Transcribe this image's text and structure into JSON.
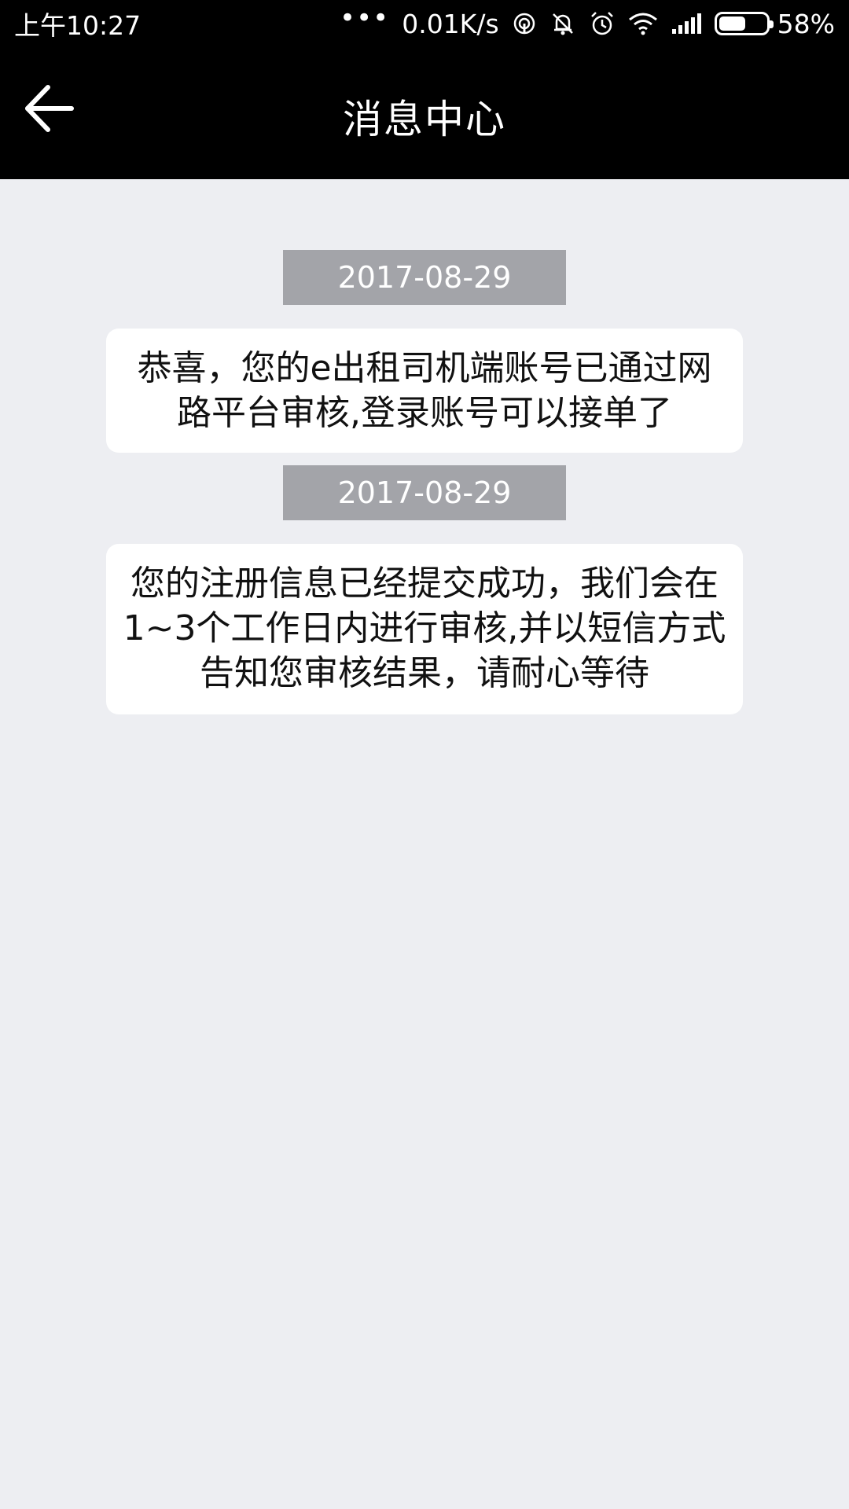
{
  "status_bar": {
    "time": "上午10:27",
    "dots": "•••",
    "network_speed": "0.01K/s",
    "battery_percent": "58%",
    "battery_level": 0.58
  },
  "header": {
    "title": "消息中心",
    "back_icon": "arrow-left-icon"
  },
  "messages": [
    {
      "date": "2017-08-29",
      "text": "恭喜，您的e出租司机端账号已通过网路平台审核,登录账号可以接单了"
    },
    {
      "date": "2017-08-29",
      "text": "您的注册信息已经提交成功，我们会在1~3个工作日内进行审核,并以短信方式告知您审核结果，请耐心等待"
    }
  ],
  "colors": {
    "header_bg": "#000000",
    "page_bg": "#edeef2",
    "date_chip_bg": "#a3a4a9",
    "bubble_bg": "#ffffff"
  }
}
